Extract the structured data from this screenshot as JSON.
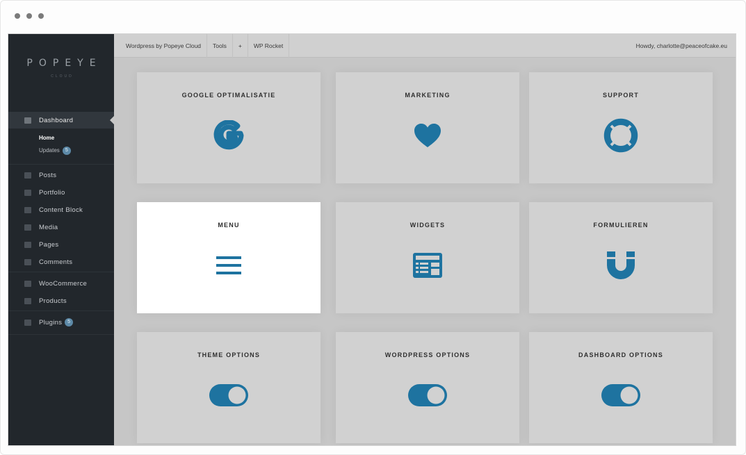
{
  "brand": {
    "logo_text": "PΟPEYE",
    "logo_sub": "CLOUD"
  },
  "colors": {
    "accent": "#1e73a0",
    "sidebar_bg": "#22272c",
    "content_bg": "#c6c6c6",
    "tile_bg": "#d1d1d1",
    "badge": "#5d8aa8"
  },
  "topbar": {
    "site": "Wordpress by Popeye Cloud",
    "tools": "Tools",
    "plus": "+",
    "wp_rocket": "WP Rocket",
    "howdy": "Howdy, charlotte@peaceofcake.eu"
  },
  "sidebar": {
    "dashboard": "Dashboard",
    "home": "Home",
    "updates": "Updates",
    "updates_count": "5",
    "posts": "Posts",
    "portfolio": "Portfolio",
    "content_block": "Content Block",
    "media": "Media",
    "pages": "Pages",
    "comments": "Comments",
    "woocommerce": "WooCommerce",
    "products": "Products",
    "plugins": "Plugins",
    "plugins_count": "5"
  },
  "tiles": [
    {
      "title": "GOOGLE OPTIMALISATIE",
      "icon": "google-g-icon"
    },
    {
      "title": "MARKETING",
      "icon": "heart-icon"
    },
    {
      "title": "SUPPORT",
      "icon": "lifebuoy-icon"
    },
    {
      "title": "MENU",
      "icon": "hamburger-icon",
      "highlighted": true
    },
    {
      "title": "WIDGETS",
      "icon": "widgets-icon"
    },
    {
      "title": "FORMULIEREN",
      "icon": "magnet-icon"
    },
    {
      "title": "THEME OPTIONS",
      "icon": "toggle-icon"
    },
    {
      "title": "WORDPRESS OPTIONS",
      "icon": "toggle-icon"
    },
    {
      "title": "DASHBOARD OPTIONS",
      "icon": "toggle-icon"
    }
  ]
}
